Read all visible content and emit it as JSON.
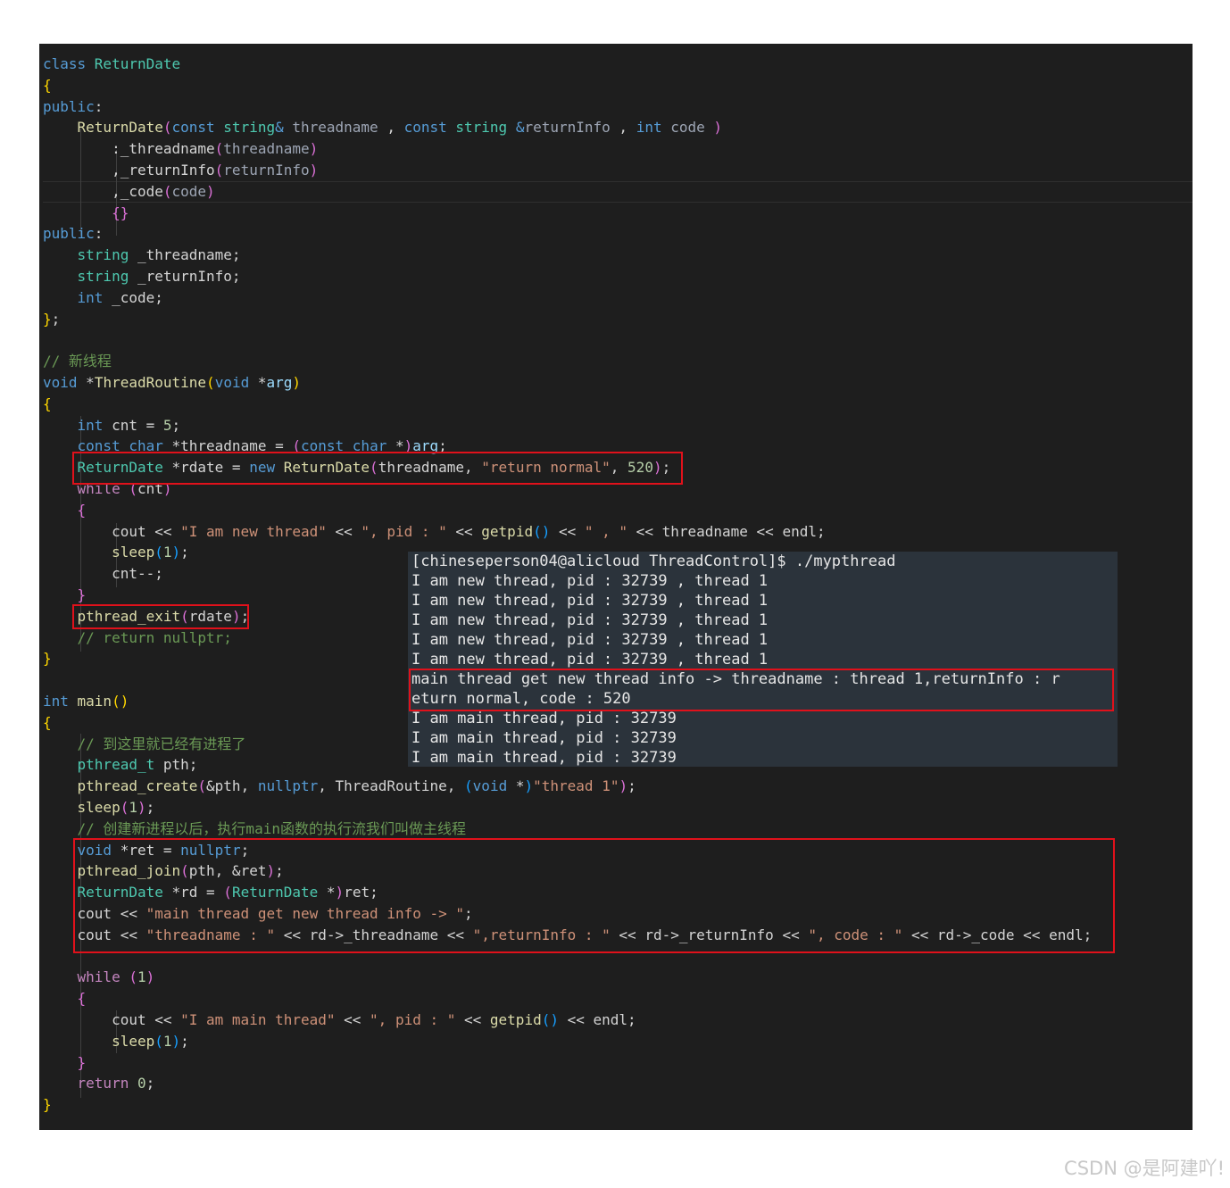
{
  "code_lines": [
    [
      [
        "kw",
        "class "
      ],
      [
        "ty",
        "ReturnDate"
      ]
    ],
    [
      [
        "bk1",
        "{"
      ]
    ],
    [
      [
        "kw",
        "public"
      ],
      [
        "",
        ":"
      ]
    ],
    [
      [
        "",
        "    "
      ],
      [
        "fn",
        "ReturnDate"
      ],
      [
        "bk2",
        "("
      ],
      [
        "kw",
        "const "
      ],
      [
        "ty",
        "string"
      ],
      [
        "kw",
        "& "
      ],
      [
        "pm",
        "threadname"
      ],
      [
        "",
        " , "
      ],
      [
        "kw",
        "const "
      ],
      [
        "ty",
        "string "
      ],
      [
        "kw",
        "&"
      ],
      [
        "pm",
        "returnInfo"
      ],
      [
        "",
        " , "
      ],
      [
        "kw",
        "int "
      ],
      [
        "pm",
        "code "
      ],
      [
        "bk2",
        ")"
      ]
    ],
    [
      [
        "",
        "        :_threadname"
      ],
      [
        "bk2",
        "("
      ],
      [
        "pm",
        "threadname"
      ],
      [
        "bk2",
        ")"
      ]
    ],
    [
      [
        "",
        "        ,_returnInfo"
      ],
      [
        "bk2",
        "("
      ],
      [
        "pm",
        "returnInfo"
      ],
      [
        "bk2",
        ")"
      ]
    ],
    [
      [
        "",
        "        ,_code"
      ],
      [
        "bk2",
        "("
      ],
      [
        "pm",
        "code"
      ],
      [
        "bk2",
        ")"
      ]
    ],
    [
      [
        "",
        "        "
      ],
      [
        "bk2",
        "{}"
      ]
    ],
    [
      [
        "kw",
        "public"
      ],
      [
        "",
        ":"
      ]
    ],
    [
      [
        "",
        "    "
      ],
      [
        "ty",
        "string"
      ],
      [
        "",
        " _threadname;"
      ]
    ],
    [
      [
        "",
        "    "
      ],
      [
        "ty",
        "string"
      ],
      [
        "",
        " _returnInfo;"
      ]
    ],
    [
      [
        "",
        "    "
      ],
      [
        "kw",
        "int"
      ],
      [
        "",
        " _code;"
      ]
    ],
    [
      [
        "bk1",
        "}"
      ],
      [
        "",
        ";"
      ]
    ],
    [],
    [
      [
        "cm",
        "// 新线程"
      ]
    ],
    [
      [
        "kw",
        "void "
      ],
      [
        "",
        "*"
      ],
      [
        "fn",
        "ThreadRoutine"
      ],
      [
        "bk1",
        "("
      ],
      [
        "kw",
        "void "
      ],
      [
        "",
        "*"
      ],
      [
        "vr",
        "arg"
      ],
      [
        "bk1",
        ")"
      ]
    ],
    [
      [
        "bk1",
        "{"
      ]
    ],
    [
      [
        "",
        "    "
      ],
      [
        "kw",
        "int"
      ],
      [
        "",
        " cnt = "
      ],
      [
        "nm",
        "5"
      ],
      [
        "",
        ";"
      ]
    ],
    [
      [
        "",
        "    "
      ],
      [
        "kw",
        "const char "
      ],
      [
        "",
        "*threadname = "
      ],
      [
        "bk2",
        "("
      ],
      [
        "kw",
        "const char "
      ],
      [
        "",
        "*"
      ],
      [
        "bk2",
        ")"
      ],
      [
        "vr",
        "arg"
      ],
      [
        "",
        ";"
      ]
    ],
    [
      [
        "",
        "    "
      ],
      [
        "ty",
        "ReturnDate"
      ],
      [
        "",
        " *rdate = "
      ],
      [
        "kw",
        "new "
      ],
      [
        "fn",
        "ReturnDate"
      ],
      [
        "bk2",
        "("
      ],
      [
        "",
        "threadname, "
      ],
      [
        "st",
        "\"return normal\""
      ],
      [
        "",
        ", "
      ],
      [
        "nm",
        "520"
      ],
      [
        "bk2",
        ")"
      ],
      [
        "",
        ";"
      ]
    ],
    [
      [
        "",
        "    "
      ],
      [
        "ctl",
        "while "
      ],
      [
        "bk2",
        "("
      ],
      [
        "",
        "cnt"
      ],
      [
        "bk2",
        ")"
      ]
    ],
    [
      [
        "",
        "    "
      ],
      [
        "bk2",
        "{"
      ]
    ],
    [
      [
        "",
        "        cout << "
      ],
      [
        "st",
        "\"I am new thread\""
      ],
      [
        "",
        " << "
      ],
      [
        "st",
        "\", pid : \""
      ],
      [
        "",
        " << "
      ],
      [
        "fn",
        "getpid"
      ],
      [
        "bk3",
        "()"
      ],
      [
        "",
        " << "
      ],
      [
        "st",
        "\" , \""
      ],
      [
        "",
        " << threadname << endl;"
      ]
    ],
    [
      [
        "",
        "        "
      ],
      [
        "fn",
        "sleep"
      ],
      [
        "bk3",
        "("
      ],
      [
        "nm",
        "1"
      ],
      [
        "bk3",
        ")"
      ],
      [
        "",
        ";"
      ]
    ],
    [
      [
        "",
        "        cnt--;"
      ]
    ],
    [
      [
        "",
        "    "
      ],
      [
        "bk2",
        "}"
      ]
    ],
    [
      [
        "",
        "    "
      ],
      [
        "fn",
        "pthread_exit"
      ],
      [
        "bk2",
        "("
      ],
      [
        "",
        "rdate"
      ],
      [
        "bk2",
        ")"
      ],
      [
        "",
        ";"
      ]
    ],
    [
      [
        "",
        "    "
      ],
      [
        "cm",
        "// return nullptr;"
      ]
    ],
    [
      [
        "bk1",
        "}"
      ]
    ],
    [],
    [
      [
        "kw",
        "int "
      ],
      [
        "fn",
        "main"
      ],
      [
        "bk1",
        "()"
      ]
    ],
    [
      [
        "bk1",
        "{"
      ]
    ],
    [
      [
        "",
        "    "
      ],
      [
        "cm",
        "// 到这里就已经有进程了"
      ]
    ],
    [
      [
        "",
        "    "
      ],
      [
        "ty",
        "pthread_t"
      ],
      [
        "",
        " pth;"
      ]
    ],
    [
      [
        "",
        "    "
      ],
      [
        "fn",
        "pthread_create"
      ],
      [
        "bk2",
        "("
      ],
      [
        "",
        "&pth, "
      ],
      [
        "kw",
        "nullptr"
      ],
      [
        "",
        ", ThreadRoutine, "
      ],
      [
        "bk3",
        "("
      ],
      [
        "kw",
        "void "
      ],
      [
        "",
        "*"
      ],
      [
        "bk3",
        ")"
      ],
      [
        "st",
        "\"thread 1\""
      ],
      [
        "bk2",
        ")"
      ],
      [
        "",
        ";"
      ]
    ],
    [
      [
        "",
        "    "
      ],
      [
        "fn",
        "sleep"
      ],
      [
        "bk2",
        "("
      ],
      [
        "nm",
        "1"
      ],
      [
        "bk2",
        ")"
      ],
      [
        "",
        ";"
      ]
    ],
    [
      [
        "",
        "    "
      ],
      [
        "cm",
        "// 创建新进程以后，执行main函数的执行流我们叫做主线程"
      ]
    ],
    [
      [
        "",
        "    "
      ],
      [
        "kw",
        "void "
      ],
      [
        "",
        "*ret = "
      ],
      [
        "kw",
        "nullptr"
      ],
      [
        "",
        ";"
      ]
    ],
    [
      [
        "",
        "    "
      ],
      [
        "fn",
        "pthread_join"
      ],
      [
        "bk2",
        "("
      ],
      [
        "",
        "pth, &ret"
      ],
      [
        "bk2",
        ")"
      ],
      [
        "",
        ";"
      ]
    ],
    [
      [
        "",
        "    "
      ],
      [
        "ty",
        "ReturnDate"
      ],
      [
        "",
        " *rd = "
      ],
      [
        "bk2",
        "("
      ],
      [
        "ty",
        "ReturnDate "
      ],
      [
        "",
        "*"
      ],
      [
        "bk2",
        ")"
      ],
      [
        "",
        "ret;"
      ]
    ],
    [
      [
        "",
        "    cout << "
      ],
      [
        "st",
        "\"main thread get new thread info -> \""
      ],
      [
        "",
        ";"
      ]
    ],
    [
      [
        "",
        "    cout << "
      ],
      [
        "st",
        "\"threadname : \""
      ],
      [
        "",
        " << rd->_threadname << "
      ],
      [
        "st",
        "\",returnInfo : \""
      ],
      [
        "",
        " << rd->_returnInfo << "
      ],
      [
        "st",
        "\", code : \""
      ],
      [
        "",
        " << rd->_code << endl;"
      ]
    ],
    [],
    [
      [
        "",
        "    "
      ],
      [
        "ctl",
        "while "
      ],
      [
        "bk2",
        "("
      ],
      [
        "nm",
        "1"
      ],
      [
        "bk2",
        ")"
      ]
    ],
    [
      [
        "",
        "    "
      ],
      [
        "bk2",
        "{"
      ]
    ],
    [
      [
        "",
        "        cout << "
      ],
      [
        "st",
        "\"I am main thread\""
      ],
      [
        "",
        " << "
      ],
      [
        "st",
        "\", pid : \""
      ],
      [
        "",
        " << "
      ],
      [
        "fn",
        "getpid"
      ],
      [
        "bk3",
        "()"
      ],
      [
        "",
        " << endl;"
      ]
    ],
    [
      [
        "",
        "        "
      ],
      [
        "fn",
        "sleep"
      ],
      [
        "bk3",
        "("
      ],
      [
        "nm",
        "1"
      ],
      [
        "bk3",
        ")"
      ],
      [
        "",
        ";"
      ]
    ],
    [
      [
        "",
        "    "
      ],
      [
        "bk2",
        "}"
      ]
    ],
    [
      [
        "",
        "    "
      ],
      [
        "ctl",
        "return "
      ],
      [
        "nm",
        "0"
      ],
      [
        "",
        ";"
      ]
    ],
    [
      [
        "bk1",
        "}"
      ]
    ]
  ],
  "terminal_lines": [
    "[chineseperson04@alicloud ThreadControl]$ ./mypthread",
    "I am new thread, pid : 32739 , thread 1",
    "I am new thread, pid : 32739 , thread 1",
    "I am new thread, pid : 32739 , thread 1",
    "I am new thread, pid : 32739 , thread 1",
    "I am new thread, pid : 32739 , thread 1",
    "main thread get new thread info -> threadname : thread 1,returnInfo : r",
    "eturn normal, code : 520",
    "I am main thread, pid : 32739",
    "I am main thread, pid : 32739",
    "I am main thread, pid : 32739"
  ],
  "watermark": "CSDN @是阿建吖!",
  "colors": {
    "editor_bg": "#1e1e1e",
    "terminal_bg": "#2b333b",
    "highlight_border": "#e0111b",
    "keyword": "#569cd6",
    "type": "#4ec9b0",
    "function": "#dcdcaa",
    "string": "#ce9178",
    "number": "#b5cea8",
    "comment": "#6a9955"
  }
}
